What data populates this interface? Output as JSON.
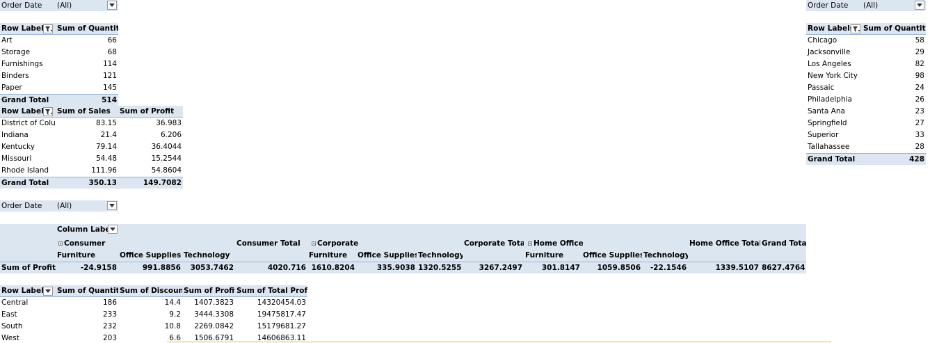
{
  "filter_top_left": {
    "label": "Order Date",
    "value": "(All)"
  },
  "filter_top_right": {
    "label": "Order Date",
    "value": "(All)"
  },
  "filter_middle": {
    "label": "Order Date",
    "value": "(All)"
  },
  "pivot_quantity": {
    "headers": [
      "Row Labels",
      "Sum of Quantity"
    ],
    "rows": [
      {
        "label": "Art",
        "qty": "66"
      },
      {
        "label": "Storage",
        "qty": "68"
      },
      {
        "label": "Furnishings",
        "qty": "114"
      },
      {
        "label": "Binders",
        "qty": "121"
      },
      {
        "label": "Paper",
        "qty": "145"
      }
    ],
    "total": {
      "label": "Grand Total",
      "qty": "514"
    }
  },
  "pivot_state": {
    "headers": [
      "Row Labels",
      "Sum of Sales",
      "Sum of Profit"
    ],
    "rows": [
      {
        "label": "District of Colu",
        "sales": "83.15",
        "profit": "36.983"
      },
      {
        "label": "Indiana",
        "sales": "21.4",
        "profit": "6.206"
      },
      {
        "label": "Kentucky",
        "sales": "79.14",
        "profit": "36.4044"
      },
      {
        "label": "Missouri",
        "sales": "54.48",
        "profit": "15.2544"
      },
      {
        "label": "Rhode Island",
        "sales": "111.96",
        "profit": "54.8604"
      }
    ],
    "total": {
      "label": "Grand Total",
      "sales": "350.13",
      "profit": "149.7082"
    }
  },
  "pivot_city": {
    "headers": [
      "Row Labels",
      "Sum of Quantity"
    ],
    "rows": [
      {
        "label": "Chicago",
        "qty": "58"
      },
      {
        "label": "Jacksonville",
        "qty": "29"
      },
      {
        "label": "Los Angeles",
        "qty": "82"
      },
      {
        "label": "New York City",
        "qty": "98"
      },
      {
        "label": "Passaic",
        "qty": "24"
      },
      {
        "label": "Philadelphia",
        "qty": "26"
      },
      {
        "label": "Santa Ana",
        "qty": "23"
      },
      {
        "label": "Springfield",
        "qty": "27"
      },
      {
        "label": "Superior",
        "qty": "33"
      },
      {
        "label": "Tallahassee",
        "qty": "28"
      }
    ],
    "total": {
      "label": "Grand Total",
      "qty": "428"
    }
  },
  "pivot_segment": {
    "column_labels": "Column Labels",
    "segments": [
      "Consumer",
      "Corporate",
      "Home Office"
    ],
    "segment_totals": [
      "Consumer Total",
      "Corporate Total",
      "Home Office Total"
    ],
    "grand_total_label": "Grand Total",
    "categories": [
      "Furniture",
      "Office Supplies",
      "Technology"
    ],
    "row_label": "Sum of Profit",
    "values": [
      "-24.9158",
      "991.8856",
      "3053.7462",
      "4020.716",
      "1610.8204",
      "335.9038",
      "1320.5255",
      "3267.2497",
      "301.8147",
      "1059.8506",
      "-22.1546",
      "1339.5107",
      "8627.4764"
    ]
  },
  "pivot_region": {
    "headers": [
      "Row Labels",
      "Sum of Quantity",
      "Sum of Discount",
      "Sum of Profit",
      "Sum of Total Profit"
    ],
    "rows": [
      {
        "label": "Central",
        "qty": "186",
        "discount": "14.4",
        "profit": "1407.3823",
        "total_profit": "14320454.03"
      },
      {
        "label": "East",
        "qty": "233",
        "discount": "9.2",
        "profit": "3444.3308",
        "total_profit": "19475817.47"
      },
      {
        "label": "South",
        "qty": "232",
        "discount": "10.8",
        "profit": "2269.0842",
        "total_profit": "15179681.27"
      },
      {
        "label": "West",
        "qty": "203",
        "discount": "6.6",
        "profit": "1506.6791",
        "total_profit": "14606863.11"
      }
    ]
  },
  "icons": {
    "dropdown": "chevron-down-icon",
    "filter": "filter-icon",
    "collapse": "collapse-minus-icon"
  },
  "colors": {
    "header_band": "#dce6f1",
    "header_border": "#95b3d7",
    "subtotal_grey": "#d9d9d9"
  }
}
